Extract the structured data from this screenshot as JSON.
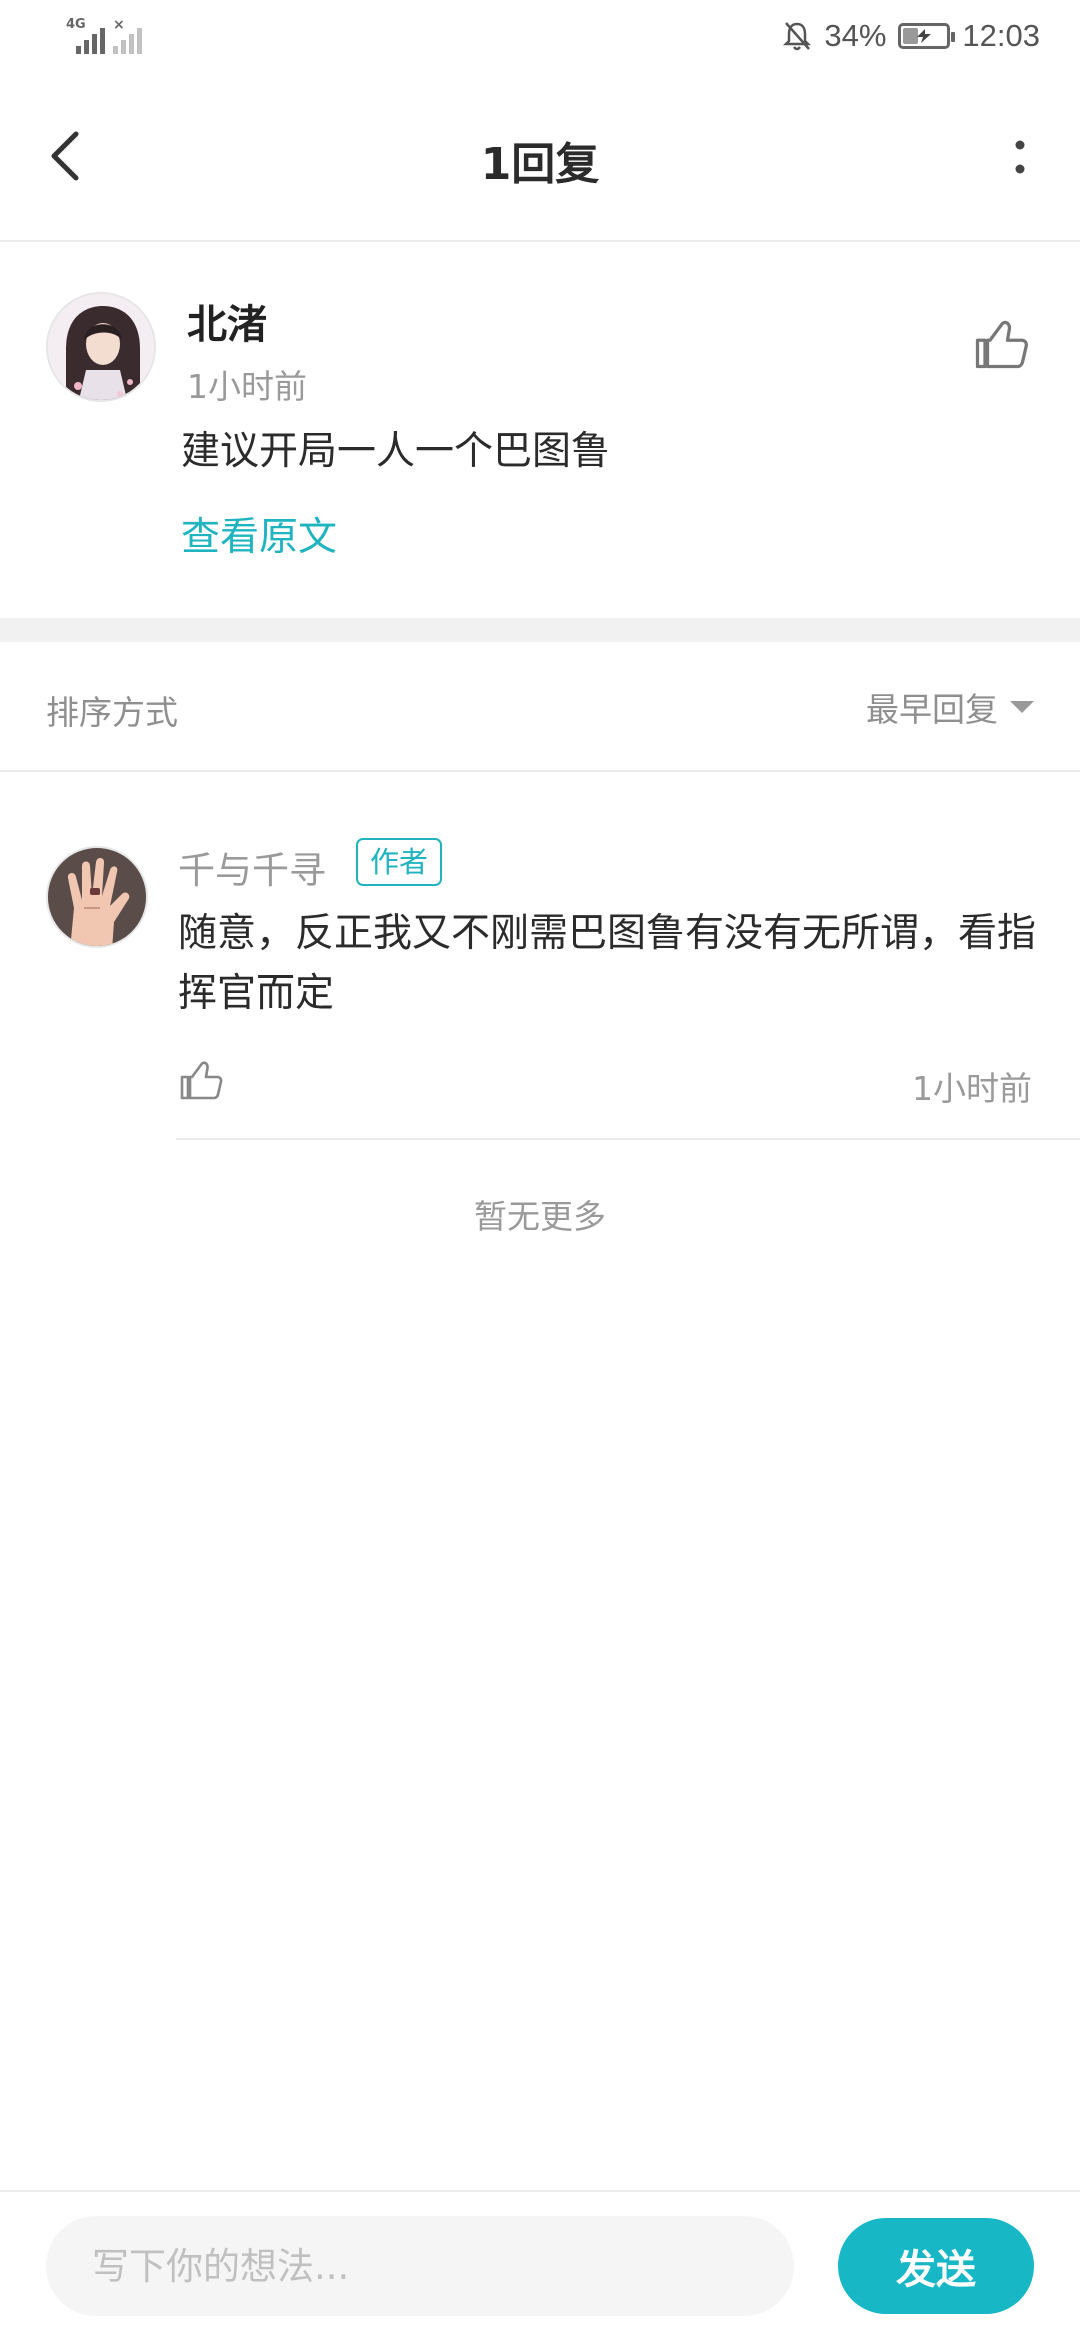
{
  "status_bar": {
    "network_label": "4G",
    "battery_percent": "34%",
    "battery_level": 0.34,
    "time": "12:03",
    "icons": [
      "signal-icon",
      "no-signal-icon",
      "mute-bell-icon",
      "battery-icon"
    ]
  },
  "header": {
    "title": "1回复",
    "back_icon": "chevron-left-icon",
    "more_icon": "more-vertical-icon"
  },
  "original_comment": {
    "author": "北渚",
    "time": "1小时前",
    "text": "建议开局一人一个巴图鲁",
    "view_original_label": "查看原文",
    "like_icon": "thumbs-up-icon"
  },
  "sort": {
    "label": "排序方式",
    "selected": "最早回复"
  },
  "replies": [
    {
      "author": "千与千寻",
      "badge": "作者",
      "text": "随意，反正我又不刚需巴图鲁有没有无所谓，看指挥官而定",
      "time": "1小时前"
    }
  ],
  "no_more_label": "暂无更多",
  "composer": {
    "placeholder": "写下你的想法...",
    "send_label": "发送"
  },
  "colors": {
    "accent": "#17b7c5",
    "link": "#1fb4bf",
    "muted_text": "#9a9a9a"
  }
}
